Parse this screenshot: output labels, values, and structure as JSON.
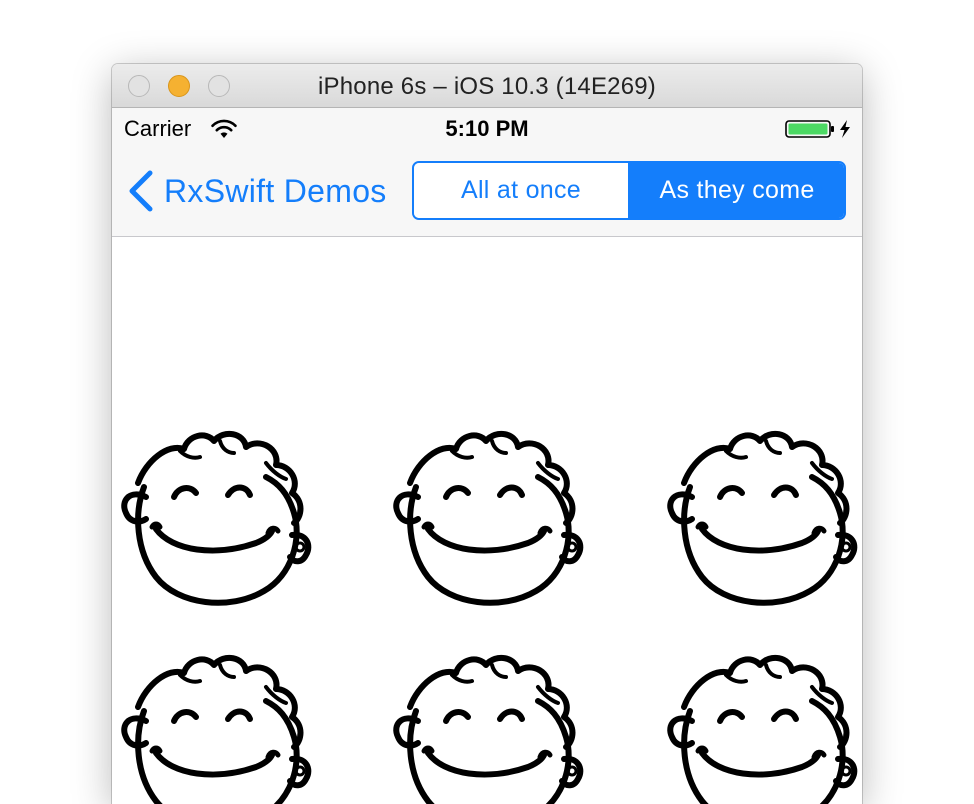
{
  "window": {
    "title": "iPhone 6s – iOS 10.3 (14E269)"
  },
  "status_bar": {
    "carrier": "Carrier",
    "time": "5:10 PM",
    "battery_color": "#4cd964",
    "icons": [
      "wifi-icon",
      "battery-icon",
      "charging-bolt-icon"
    ]
  },
  "nav_bar": {
    "back_label": "RxSwift Demos",
    "accent_color": "#147efb",
    "segments": [
      {
        "label": "All at once",
        "selected": false
      },
      {
        "label": "As they come",
        "selected": true
      }
    ]
  },
  "grid": {
    "columns": 3,
    "image_icon": "smiley-face-icon",
    "visible_cells": 6
  }
}
